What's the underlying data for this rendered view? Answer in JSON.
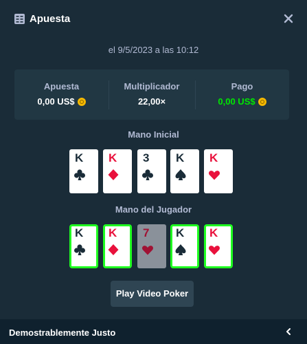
{
  "header": {
    "title": "Apuesta"
  },
  "date": "el 9/5/2023 a las 10:12",
  "stats": [
    {
      "label": "Apuesta",
      "value": "0,00 US$",
      "currency_icon": "coin-icon"
    },
    {
      "label": "Multiplicador",
      "value": "22,00×"
    },
    {
      "label": "Pago",
      "value": "0,00 US$",
      "currency_icon": "coin-icon",
      "color": "#00e701"
    }
  ],
  "initial_hand": {
    "label": "Mano Inicial",
    "cards": [
      {
        "rank": "K",
        "suit": "clubs"
      },
      {
        "rank": "K",
        "suit": "diamonds"
      },
      {
        "rank": "3",
        "suit": "clubs"
      },
      {
        "rank": "K",
        "suit": "spades"
      },
      {
        "rank": "K",
        "suit": "hearts"
      }
    ]
  },
  "player_hand": {
    "label": "Mano del Jugador",
    "cards": [
      {
        "rank": "K",
        "suit": "clubs",
        "held": true
      },
      {
        "rank": "K",
        "suit": "diamonds",
        "held": true
      },
      {
        "rank": "7",
        "suit": "hearts",
        "held": false
      },
      {
        "rank": "K",
        "suit": "spades",
        "held": true
      },
      {
        "rank": "K",
        "suit": "hearts",
        "held": true
      }
    ]
  },
  "play_button": "Play Video Poker",
  "footer": {
    "label": "Demostrablemente Justo"
  },
  "colors": {
    "background": "#1a2c38",
    "panel": "#213743",
    "win_green": "#00e701",
    "held_border": "#1fff20",
    "red_suit": "#e9113c"
  }
}
